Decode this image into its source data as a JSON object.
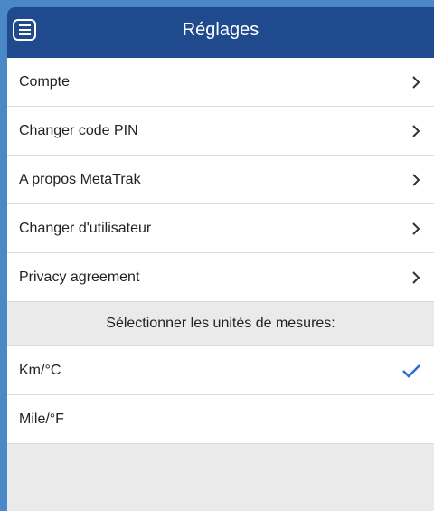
{
  "header": {
    "title": "Réglages",
    "menu_icon": "menu-icon"
  },
  "settings": {
    "items": [
      {
        "label": "Compte",
        "icon": "chevron-right-icon"
      },
      {
        "label": "Changer code PIN",
        "icon": "chevron-right-icon"
      },
      {
        "label": "A propos MetaTrak",
        "icon": "chevron-right-icon"
      },
      {
        "label": "Changer d'utilisateur",
        "icon": "chevron-right-icon"
      },
      {
        "label": "Privacy agreement",
        "icon": "chevron-right-icon"
      }
    ]
  },
  "units": {
    "section_title": "Sélectionner les unités de mesures:",
    "options": [
      {
        "label": "Km/°C",
        "selected": true
      },
      {
        "label": "Mile/°F",
        "selected": false
      }
    ],
    "check_icon": "checkmark-icon"
  },
  "colors": {
    "header_bg": "#1f4a8d",
    "accent": "#2f6fd1",
    "frame_border": "#4a88c7"
  }
}
